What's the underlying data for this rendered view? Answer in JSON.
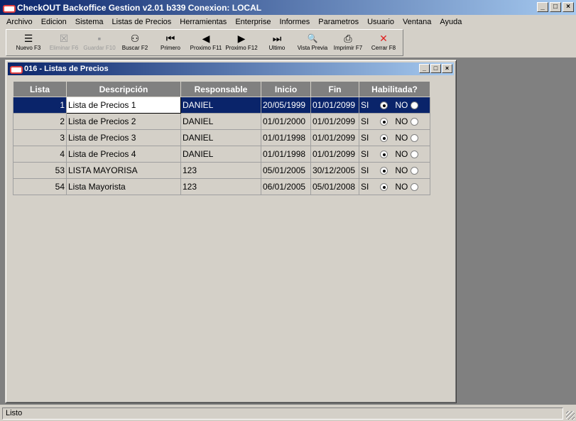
{
  "window": {
    "title": "CheckOUT Backoffice Gestion v2.01 b339 Conexion: LOCAL",
    "min": "_",
    "max": "□",
    "close": "×"
  },
  "menu": [
    "Archivo",
    "Edicion",
    "Sistema",
    "Listas de Precios",
    "Herramientas",
    "Enterprise",
    "Informes",
    "Parametros",
    "Usuario",
    "Ventana",
    "Ayuda"
  ],
  "toolbar": [
    {
      "label": "Nuevo F3",
      "icon": "new-list-icon",
      "glyph": "☰",
      "enabled": true
    },
    {
      "label": "Eliminar F6",
      "icon": "delete-list-icon",
      "glyph": "☒",
      "enabled": false
    },
    {
      "label": "Guardar F10",
      "icon": "save-icon",
      "glyph": "▪",
      "enabled": false
    },
    {
      "label": "Buscar F2",
      "icon": "binoculars-icon",
      "glyph": "⚇",
      "enabled": true
    },
    {
      "label": "Primero",
      "icon": "first-icon",
      "glyph": "⏮",
      "enabled": true
    },
    {
      "label": "Proximo F11",
      "icon": "previous-icon",
      "glyph": "◀",
      "enabled": true
    },
    {
      "label": "Proximo F12",
      "icon": "next-icon",
      "glyph": "▶",
      "enabled": true
    },
    {
      "label": "Ultimo",
      "icon": "last-icon",
      "glyph": "⏭",
      "enabled": true
    },
    {
      "label": "Vista Previa",
      "icon": "preview-icon",
      "glyph": "🔍",
      "enabled": true
    },
    {
      "label": "Imprimir F7",
      "icon": "printer-icon",
      "glyph": "⎙",
      "enabled": true
    },
    {
      "label": "Cerrar F8",
      "icon": "close-x-icon",
      "glyph": "✕",
      "enabled": true
    }
  ],
  "child": {
    "title": "016 - Listas de Precios"
  },
  "grid": {
    "columns": [
      "Lista",
      "Descripción",
      "Responsable",
      "Inicio",
      "Fin",
      "Habilitada?"
    ],
    "rows": [
      {
        "lista": "1",
        "descripcion": "Lista de Precios 1",
        "responsable": "DANIEL",
        "inicio": "20/05/1999",
        "fin": "01/01/2099",
        "si": "SI",
        "no": "NO",
        "habilitada": true
      },
      {
        "lista": "2",
        "descripcion": "Lista de Precios 2",
        "responsable": "DANIEL",
        "inicio": "01/01/2000",
        "fin": "01/01/2099",
        "si": "SI",
        "no": "NO",
        "habilitada": true
      },
      {
        "lista": "3",
        "descripcion": "Lista de Precios 3",
        "responsable": "DANIEL",
        "inicio": "01/01/1998",
        "fin": "01/01/2099",
        "si": "SI",
        "no": "NO",
        "habilitada": true
      },
      {
        "lista": "4",
        "descripcion": "Lista de Precios 4",
        "responsable": "DANIEL",
        "inicio": "01/01/1998",
        "fin": "01/01/2099",
        "si": "SI",
        "no": "NO",
        "habilitada": true
      },
      {
        "lista": "53",
        "descripcion": "LISTA MAYORISA",
        "responsable": "123",
        "inicio": "05/01/2005",
        "fin": "30/12/2005",
        "si": "SI",
        "no": "NO",
        "habilitada": true
      },
      {
        "lista": "54",
        "descripcion": "Lista Mayorista",
        "responsable": "123",
        "inicio": "06/01/2005",
        "fin": "05/01/2008",
        "si": "SI",
        "no": "NO",
        "habilitada": true
      }
    ]
  },
  "status": {
    "text": "Listo"
  }
}
